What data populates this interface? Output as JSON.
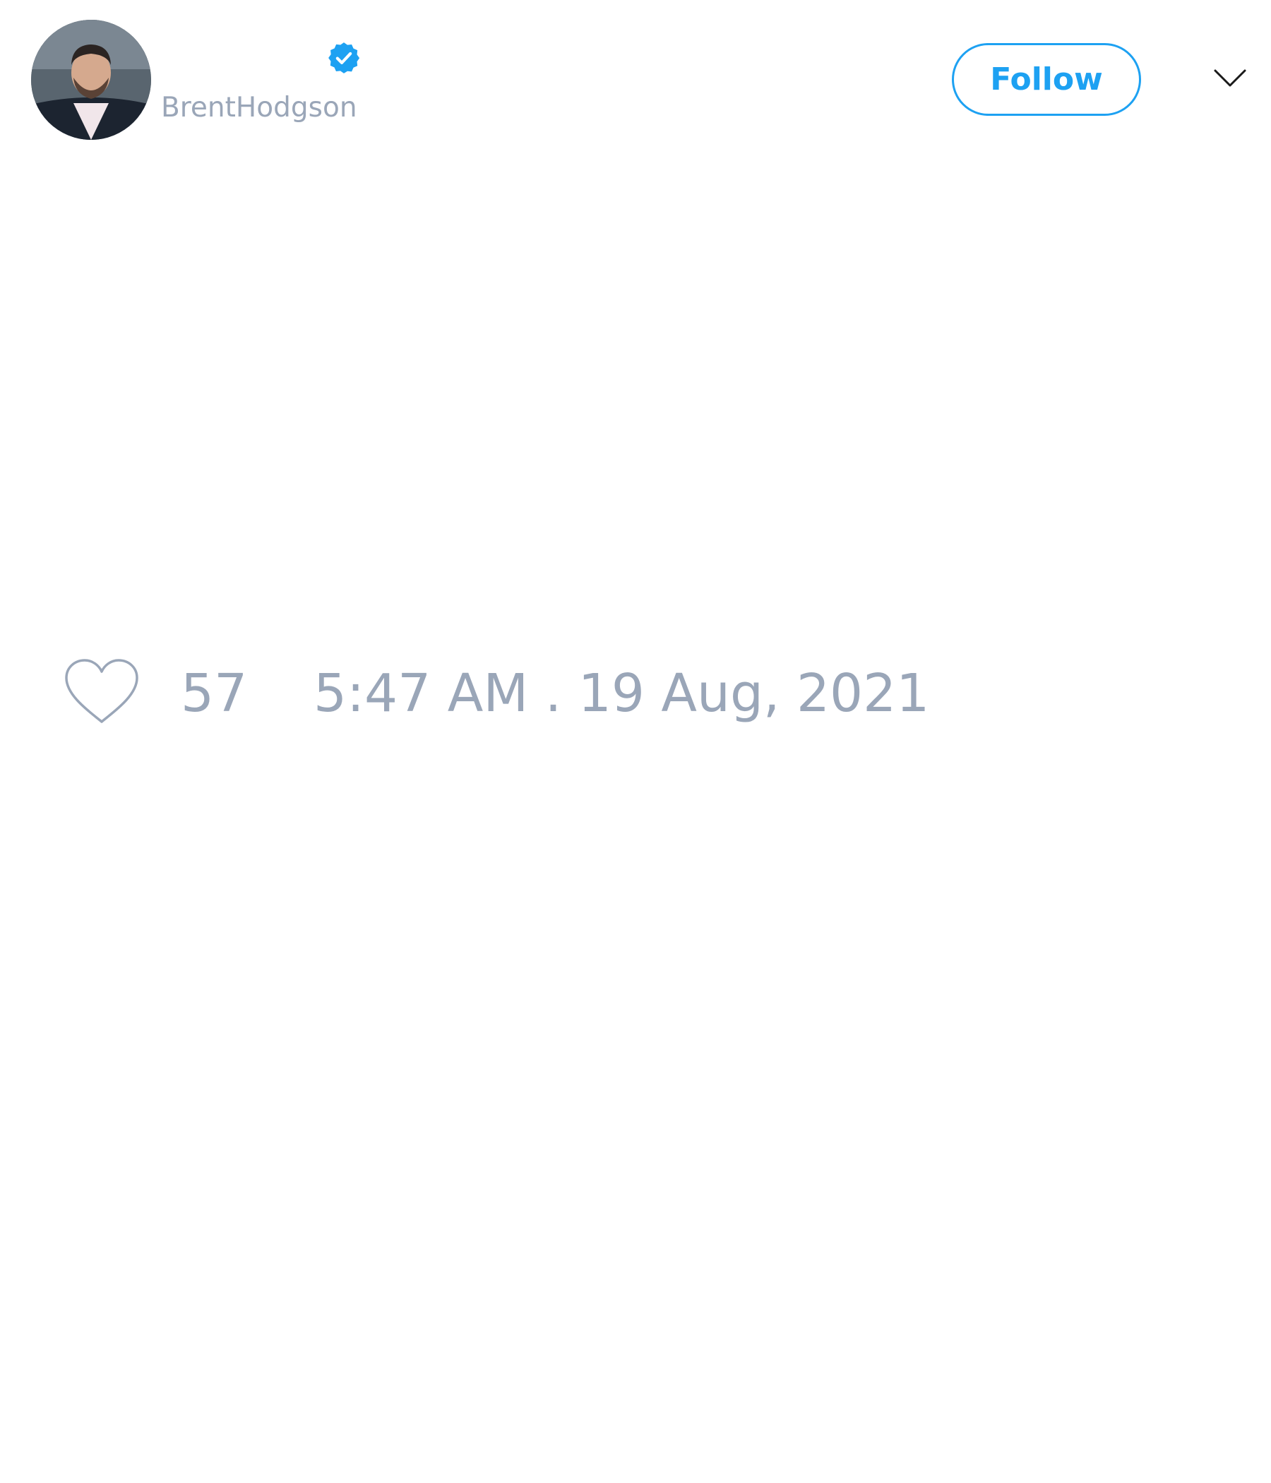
{
  "author": {
    "handle": "BrentHodgson",
    "verified": true,
    "avatar_icon": "profile-photo-avatar"
  },
  "header": {
    "follow_label": "Follow",
    "menu_icon": "chevron-down-icon"
  },
  "stats": {
    "like_icon": "heart-icon",
    "likes": "57",
    "timestamp": "5:47 AM . 19 Aug, 2021"
  },
  "colors": {
    "accent": "#1da1f2",
    "muted_text": "#9aa6b8",
    "background": "#ffffff"
  }
}
